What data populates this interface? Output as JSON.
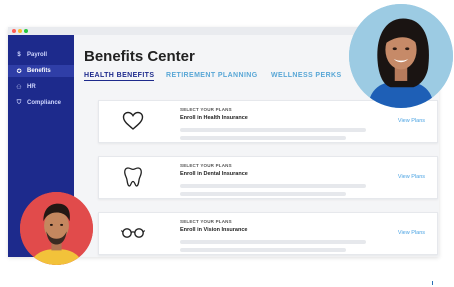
{
  "colors": {
    "sidebar": "#1d2a8c",
    "sidebar_active": "#2f3ea7",
    "accent_link": "#4ba3e3",
    "tab_inactive": "#59a7d6",
    "window_bg": "#f4f5f7"
  },
  "window": {
    "dots": [
      "#ff5f57",
      "#febc2e",
      "#28c840"
    ]
  },
  "sidebar": {
    "items": [
      {
        "label": "Payroll",
        "icon": "dollar-icon"
      },
      {
        "label": "Benefits",
        "icon": "star-icon",
        "active": true
      },
      {
        "label": "HR",
        "icon": "people-icon"
      },
      {
        "label": "Compliance",
        "icon": "shield-icon"
      }
    ]
  },
  "page": {
    "title": "Benefits Center",
    "tabs": [
      "HEALTH BENEFITS",
      "RETIREMENT PLANNING",
      "WELLNESS PERKS"
    ]
  },
  "cards": [
    {
      "icon": "heart-icon",
      "kicker": "SELECT YOUR PLANS",
      "title": "Enroll in Health Insurance",
      "link": "View Plans"
    },
    {
      "icon": "tooth-icon",
      "kicker": "SELECT YOUR PLANS",
      "title": "Enroll in Dental Insurance",
      "link": "View Plans"
    },
    {
      "icon": "glasses-icon",
      "kicker": "SELECT YOUR PLANS",
      "title": "Enroll in Vision Insurance",
      "link": "View Plans"
    }
  ],
  "avatars": [
    "woman-avatar",
    "man-avatar"
  ]
}
